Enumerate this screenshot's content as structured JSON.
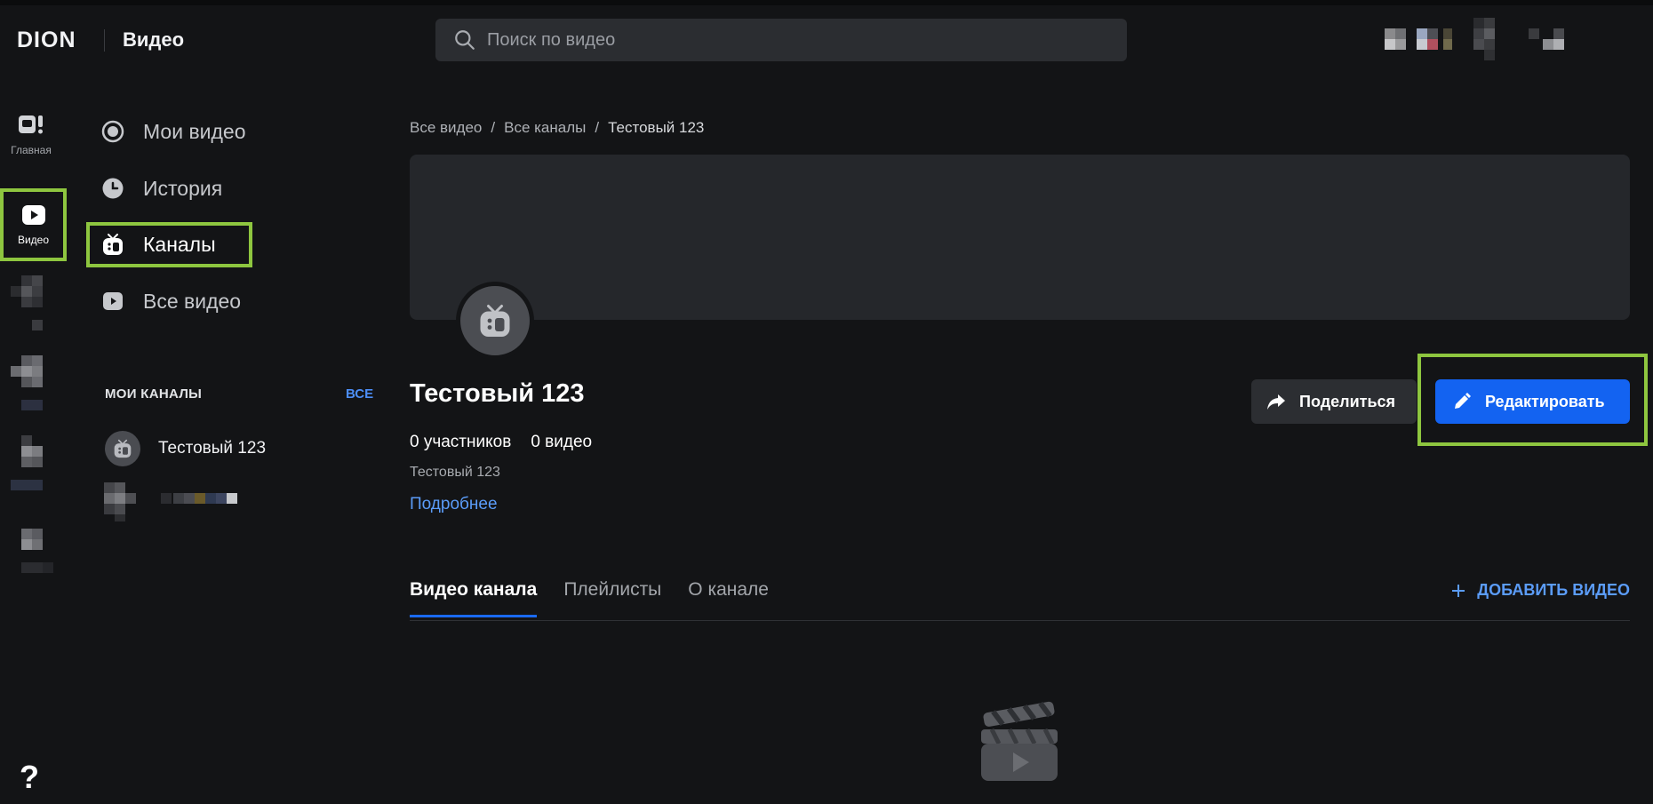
{
  "header": {
    "logo": "DION",
    "section": "Видео",
    "search_placeholder": "Поиск по видео"
  },
  "rail": {
    "home_label": "Главная",
    "video_label": "Видео",
    "help": "?"
  },
  "nav": {
    "items": [
      {
        "label": "Мои видео",
        "icon": "record-icon"
      },
      {
        "label": "История",
        "icon": "clock-icon"
      },
      {
        "label": "Каналы",
        "icon": "tv-icon"
      },
      {
        "label": "Все видео",
        "icon": "play-icon"
      }
    ],
    "my_channels_title": "МОИ КАНАЛЫ",
    "my_channels_all": "ВСЕ",
    "my_channels": [
      {
        "name": "Тестовый 123"
      }
    ]
  },
  "breadcrumb": {
    "items": [
      "Все видео",
      "/",
      "Все каналы",
      "/",
      "Тестовый 123"
    ]
  },
  "channel": {
    "title": "Тестовый 123",
    "members": "0 участников",
    "videos": "0 видео",
    "description": "Тестовый 123",
    "more_link": "Подробнее"
  },
  "actions": {
    "share": "Поделиться",
    "edit": "Редактировать"
  },
  "tabs": {
    "items": [
      "Видео канала",
      "Плейлисты",
      "О канале"
    ],
    "add_video": "ДОБАВИТЬ ВИДЕО"
  },
  "colors": {
    "accent": "#1363f1",
    "link": "#5b9cf8",
    "highlight": "#8ec63f",
    "background": "#131416"
  }
}
